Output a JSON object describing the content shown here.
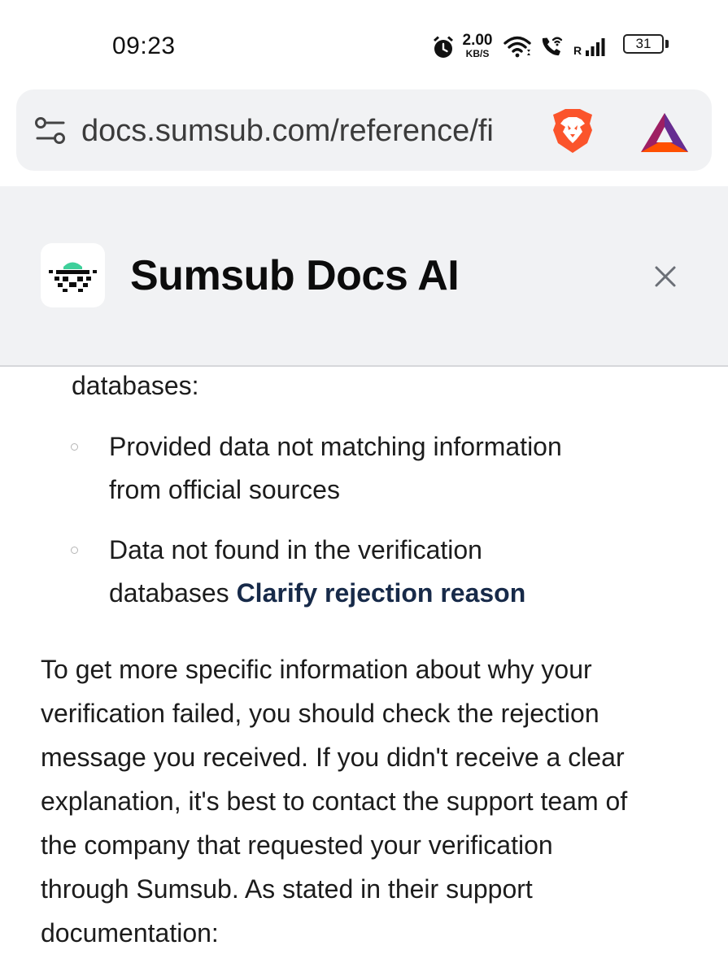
{
  "status_bar": {
    "time": "09:23",
    "net_speed_value": "2.00",
    "net_speed_unit": "KB/S",
    "network_label": "R",
    "battery_level": "31",
    "icons": [
      "alarm-icon",
      "wifi-icon",
      "wifi-calling-icon",
      "signal-icon",
      "battery-icon"
    ]
  },
  "browser": {
    "url": "docs.sumsub.com/reference/fi",
    "icons": [
      "site-settings-icon",
      "brave-lion-icon",
      "bat-rewards-icon"
    ],
    "brand_colors": {
      "brave": "#fb542b",
      "bat_primary": "#9e1f63",
      "bat_secondary": "#662d91"
    }
  },
  "ai_panel": {
    "title": "Sumsub Docs AI",
    "accent": "#3ecf9a",
    "icons": [
      "sumsub-ai-logo-icon",
      "close-icon"
    ]
  },
  "content": {
    "intro_tail": "databases:",
    "bullets": [
      {
        "lines": [
          "Provided data not matching information",
          "from official sources"
        ]
      },
      {
        "line1": "Data not found in the verification",
        "line2_prefix": "databases ",
        "link": "Clarify rejection reason"
      }
    ],
    "paragraph_lines": [
      "To get more specific information about why your",
      "verification failed, you should check the rejection",
      "message you received. If you didn't receive a clear",
      "explanation, it's best to contact the support team of",
      "the company that requested your verification",
      "through Sumsub. As stated in their support",
      "documentation:"
    ]
  }
}
